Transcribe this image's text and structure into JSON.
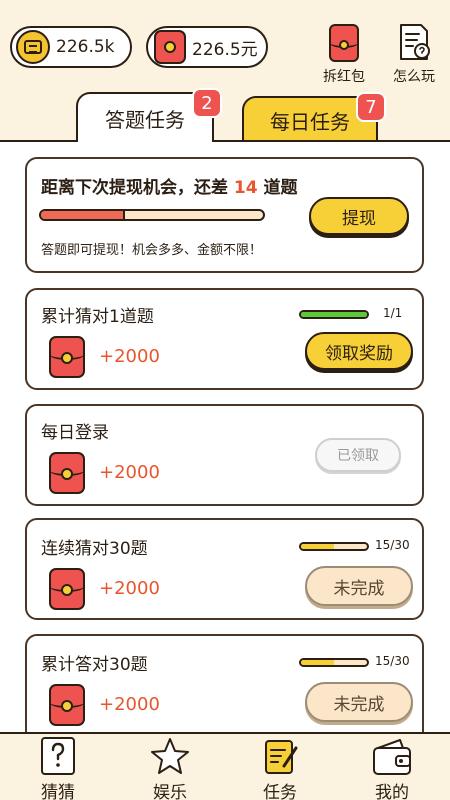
{
  "header": {
    "coins": "226.5k",
    "cash": "226.5元",
    "icons": [
      {
        "label": "拆红包",
        "icon": "red-packet-icon"
      },
      {
        "label": "怎么玩",
        "icon": "rules-icon"
      }
    ]
  },
  "tabs": [
    {
      "label": "答题任务",
      "badge": "2",
      "active": true
    },
    {
      "label": "每日任务",
      "badge": "7",
      "active": false
    }
  ],
  "withdraw_card": {
    "title_prefix": "距离下次提现机会，还差",
    "remaining": "14",
    "title_suffix": "道题",
    "progress": 0.38,
    "note": "答题即可提现！机会多多、金额不限！",
    "button": "提现"
  },
  "tasks": [
    {
      "title": "累计猜对1道题",
      "reward": "+2000",
      "progress": "1/1",
      "progress_fraction": 1.0,
      "bar_color": "#5cc93a",
      "button": "领取奖励",
      "state": "claimable"
    },
    {
      "title": "每日登录",
      "reward": "+2000",
      "progress": "",
      "progress_fraction": null,
      "bar_color": "",
      "button": "已领取",
      "state": "claimed"
    },
    {
      "title": "连续猜对30题",
      "reward": "+2000",
      "progress": "15/30",
      "progress_fraction": 0.5,
      "bar_color": "#f7d038",
      "button": "未完成",
      "state": "pending"
    },
    {
      "title": "累计答对30题",
      "reward": "+2000",
      "progress": "15/30",
      "progress_fraction": 0.5,
      "bar_color": "#f7d038",
      "button": "未完成",
      "state": "pending"
    }
  ],
  "nav": [
    {
      "label": "猜猜",
      "icon": "question-card-icon"
    },
    {
      "label": "娱乐",
      "icon": "star-icon"
    },
    {
      "label": "任务",
      "icon": "task-notebook-icon"
    },
    {
      "label": "我的",
      "icon": "wallet-icon"
    }
  ],
  "colors": {
    "background": "#fbf3df",
    "accent_yellow": "#f7d038",
    "accent_red": "#ef5350",
    "reward_text": "#e8562f"
  }
}
